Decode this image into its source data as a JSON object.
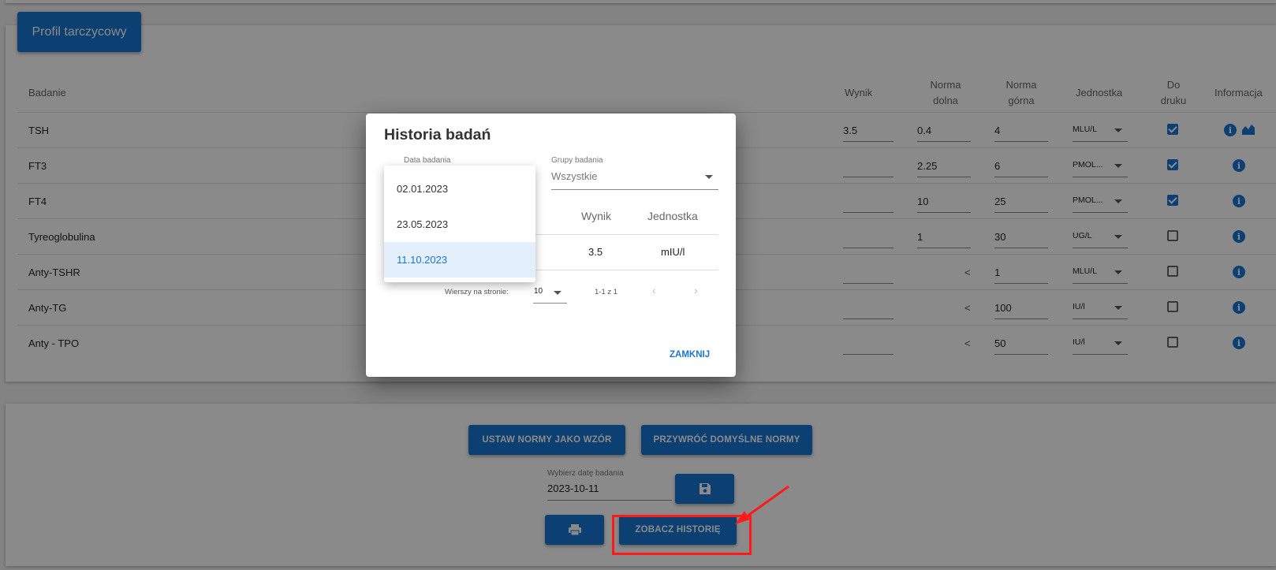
{
  "profile_button": "Profil tarczycowy",
  "table": {
    "headers": {
      "test": "Badanie",
      "result": "Wynik",
      "low_line1": "Norma",
      "low_line2": "dolna",
      "high_line1": "Norma",
      "high_line2": "górna",
      "unit": "Jednostka",
      "print_line1": "Do",
      "print_line2": "druku",
      "info": "Informacja"
    },
    "rows": [
      {
        "name": "TSH",
        "result": "3.5",
        "low": "0.4",
        "high": "4",
        "unit": "MLU/L",
        "print": true
      },
      {
        "name": "FT3",
        "result": "",
        "low": "2.25",
        "high": "6",
        "unit": "PMOL...",
        "print": true
      },
      {
        "name": "FT4",
        "result": "",
        "low": "10",
        "high": "25",
        "unit": "PMOL...",
        "print": true
      },
      {
        "name": "Tyreoglobulina",
        "result": "",
        "low": "1",
        "high": "30",
        "unit": "UG/L",
        "print": false
      },
      {
        "name": "Anty-TSHR",
        "result": "",
        "low": "<",
        "high": "1",
        "unit": "MLU/L",
        "print": false
      },
      {
        "name": "Anty-TG",
        "result": "",
        "low": "<",
        "high": "100",
        "unit": "IU/l",
        "print": false
      },
      {
        "name": "Anty - TPO",
        "result": "",
        "low": "<",
        "high": "50",
        "unit": "IU/l",
        "print": false
      }
    ]
  },
  "bottom": {
    "set_norms_button": "USTAW NORMY JAKO WZÓR",
    "restore_norms_button": "PRZYWRÓĆ DOMYŚLNE NORMY",
    "date_label": "Wybierz datę badania",
    "date_value": "2023-10-11",
    "history_button": "ZOBACZ HISTORIĘ"
  },
  "dialog": {
    "title": "Historia badań",
    "date_label": "Data badania",
    "group_label": "Grupy badania",
    "group_value": "Wszystkie",
    "date_options": [
      "02.01.2023",
      "23.05.2023",
      "11.10.2023"
    ],
    "selected_date": "11.10.2023",
    "col_result": "Wynik",
    "col_unit": "Jednostka",
    "row_result": "3.5",
    "row_unit": "mIU/l",
    "rows_per_page_label": "Wierszy na stronie:",
    "rows_per_page_value": "10",
    "page_info": "1-1 z 1",
    "close_button": "ZAMKNIJ"
  },
  "colors": {
    "primary": "#1976d2",
    "annotation": "#ff1a1a"
  }
}
